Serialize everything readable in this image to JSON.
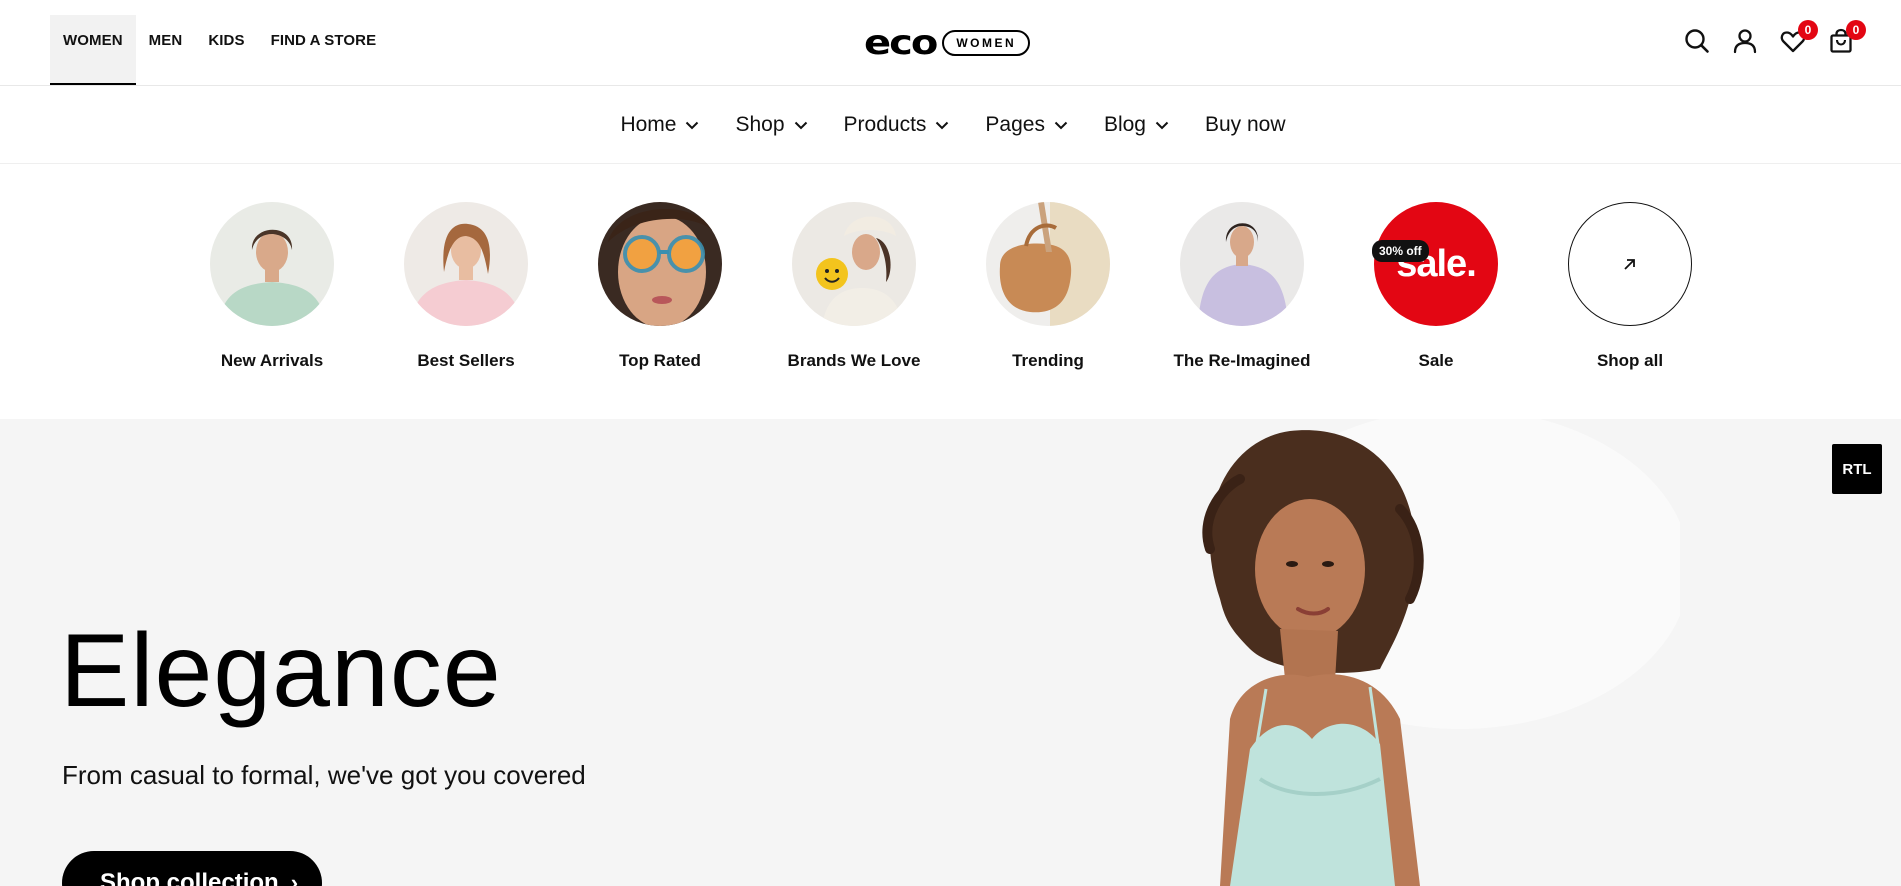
{
  "gender_nav": [
    {
      "label": "WOMEN",
      "active": true
    },
    {
      "label": "MEN",
      "active": false
    },
    {
      "label": "KIDS",
      "active": false
    },
    {
      "label": "FIND A STORE",
      "active": false
    }
  ],
  "logo": {
    "word": "eco",
    "tag": "WOMEN"
  },
  "tools": {
    "search_icon": "search-icon",
    "account_icon": "user-icon",
    "wishlist_count": "0",
    "cart_count": "0",
    "badge_color": "#e30613"
  },
  "menu": [
    {
      "label": "Home",
      "dropdown": true
    },
    {
      "label": "Shop",
      "dropdown": true
    },
    {
      "label": "Products",
      "dropdown": true
    },
    {
      "label": "Pages",
      "dropdown": true
    },
    {
      "label": "Blog",
      "dropdown": true
    },
    {
      "label": "Buy now",
      "dropdown": false
    }
  ],
  "categories": [
    {
      "label": "New Arrivals"
    },
    {
      "label": "Best Sellers"
    },
    {
      "label": "Top Rated"
    },
    {
      "label": "Brands We Love"
    },
    {
      "label": "Trending"
    },
    {
      "label": "The Re-Imagined"
    },
    {
      "label": "Sale",
      "circle_text": "sale.",
      "badge": "30% off"
    },
    {
      "label": "Shop all",
      "icon": "arrow-up-right-icon"
    }
  ],
  "hero": {
    "title": "Elegance",
    "subtitle": "From casual to formal, we've got you covered",
    "button": "Shop collection",
    "background": "#f5f5f5"
  },
  "rtl_button": "RTL"
}
